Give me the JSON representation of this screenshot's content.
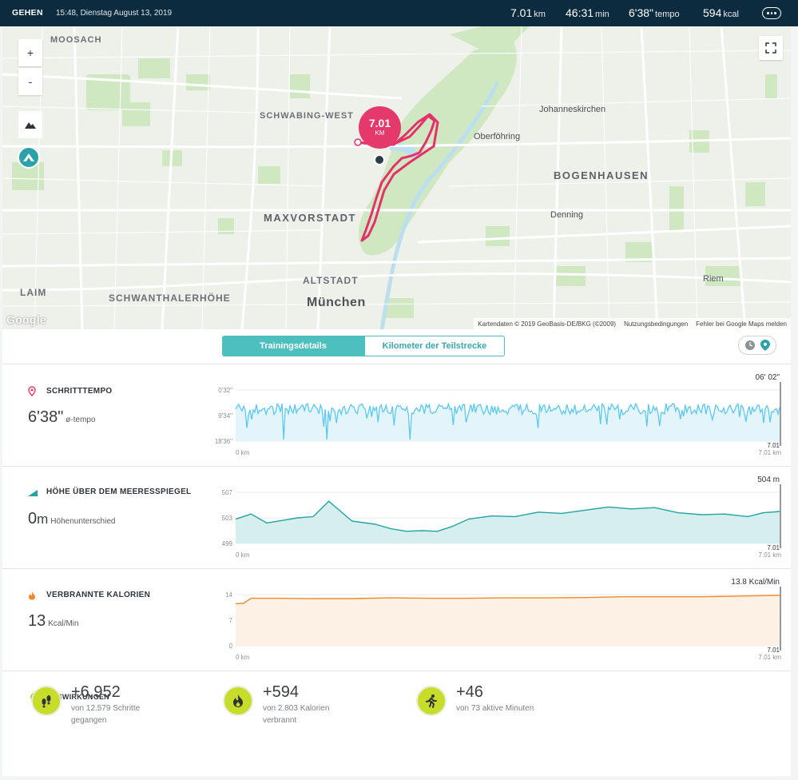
{
  "header": {
    "activity": "GEHEN",
    "datetime": "15:48, Dienstag August 13, 2019",
    "distance": {
      "value": "7.01",
      "unit": "km"
    },
    "duration": {
      "value": "46:31",
      "unit": "min"
    },
    "pace": {
      "value": "6'38\"",
      "unit": "tempo"
    },
    "calories": {
      "value": "594",
      "unit": "kcal"
    }
  },
  "map": {
    "zoom_in": "+",
    "zoom_out": "-",
    "bubble_value": "7.01",
    "bubble_unit": "KM",
    "labels": {
      "moosach": "MOOSACH",
      "schwabing_west": "SCHWABING-WEST",
      "johanneskirchen": "Johanneskirchen",
      "oberfoehring": "Oberföhring",
      "bogenhausen": "BOGENHAUSEN",
      "maxvorstadt": "MAXVORSTADT",
      "denning": "Denning",
      "altstadt": "ALTSTADT",
      "muenchen": "München",
      "laim": "LAIM",
      "schwanthalerhoehe": "SCHWANTHALERHÖHE",
      "riem": "Riem"
    },
    "google": "Google",
    "attribution": "Kartendaten © 2019 GeoBasis-DE/BKG (©2009)",
    "terms": "Nutzungsbedingungen",
    "report": "Fehler bei Google Maps melden"
  },
  "tabs": {
    "details": "Trainingsdetails",
    "splits": "Kilometer der Teilstrecke"
  },
  "pace_section": {
    "title": "SCHRITTTEMPO",
    "value": "6'38\"",
    "unit": "ø-tempo",
    "current": "06' 02\"",
    "y_ticks": [
      "0'32\"",
      "9'34\"",
      "18'36\""
    ],
    "x_start": "0 km",
    "x_end": "7.01 km",
    "x_end_top": "7.01",
    "color": "#5bc8ee"
  },
  "elevation_section": {
    "title": "HÖHE ÜBER DEM MEERESSPIEGEL",
    "value": "0",
    "value_unit": "m",
    "unit": "Höhenunterschied",
    "current": "504 m",
    "y_ticks": [
      "507",
      "503",
      "499"
    ],
    "x_start": "0 km",
    "x_end": "7.01 km",
    "x_end_top": "7.01",
    "color": "#22a4a2"
  },
  "calories_section": {
    "title": "VERBRANNTE KALORIEN",
    "value": "13",
    "unit": "Kcal/Min",
    "current": "13.8 Kcal/Min",
    "y_ticks": [
      "14",
      "7",
      "0"
    ],
    "x_start": "0 km",
    "x_end": "7.01 km",
    "x_end_top": "7.01",
    "color": "#f08a28"
  },
  "impact": {
    "title": "AUSWIRKUNGEN",
    "steps": {
      "value": "+6.952",
      "desc": "von 12.579 Schritte gegangen"
    },
    "calories": {
      "value": "+594",
      "desc": "von 2.803 Kalorien verbrannt"
    },
    "active": {
      "value": "+46",
      "desc": "von 73 aktive Minuten"
    }
  },
  "chart_data": [
    {
      "type": "line",
      "title": "SCHRITTTEMPO",
      "xlabel": "km",
      "x_range": [
        0,
        7.01
      ],
      "y_ticks": [
        "0'32\"",
        "9'34\"",
        "18'36\""
      ],
      "series": [
        {
          "values_pattern": "noisy around 6'38\" with occasional downward spikes"
        }
      ]
    },
    {
      "type": "area",
      "title": "HÖHE ÜBER DEM MEERESSPIEGEL",
      "xlabel": "km",
      "x_range": [
        0,
        7.01
      ],
      "ylim": [
        499,
        507
      ],
      "x": [
        0,
        0.2,
        0.4,
        0.6,
        0.8,
        1.0,
        1.2,
        1.5,
        1.8,
        2.0,
        2.2,
        2.4,
        2.6,
        2.8,
        3.0,
        3.3,
        3.6,
        3.9,
        4.2,
        4.5,
        4.8,
        5.1,
        5.4,
        5.7,
        6.0,
        6.3,
        6.6,
        6.8,
        7.01
      ],
      "series": [
        {
          "values": [
            502.8,
            503.6,
            502.2,
            502.6,
            503.0,
            503.2,
            505.6,
            502.5,
            502.0,
            501.3,
            500.9,
            501.0,
            500.9,
            501.7,
            502.8,
            503.3,
            503.2,
            503.9,
            503.7,
            504.2,
            504.7,
            504.4,
            504.6,
            503.8,
            503.5,
            503.6,
            503.2,
            503.8,
            504.0
          ]
        }
      ]
    },
    {
      "type": "area",
      "title": "VERBRANNTE KALORIEN",
      "xlabel": "km",
      "x_range": [
        0,
        7.01
      ],
      "ylim": [
        0,
        14
      ],
      "x": [
        0,
        0.1,
        0.2,
        0.5,
        1.0,
        1.5,
        2.0,
        2.5,
        3.0,
        3.5,
        4.0,
        4.5,
        5.0,
        5.5,
        6.0,
        6.5,
        7.01
      ],
      "series": [
        {
          "values": [
            11.5,
            11.6,
            13.0,
            13.0,
            12.9,
            12.9,
            13.1,
            13.0,
            13.0,
            13.1,
            13.1,
            13.2,
            13.4,
            13.4,
            13.4,
            13.6,
            13.8
          ]
        }
      ]
    }
  ]
}
